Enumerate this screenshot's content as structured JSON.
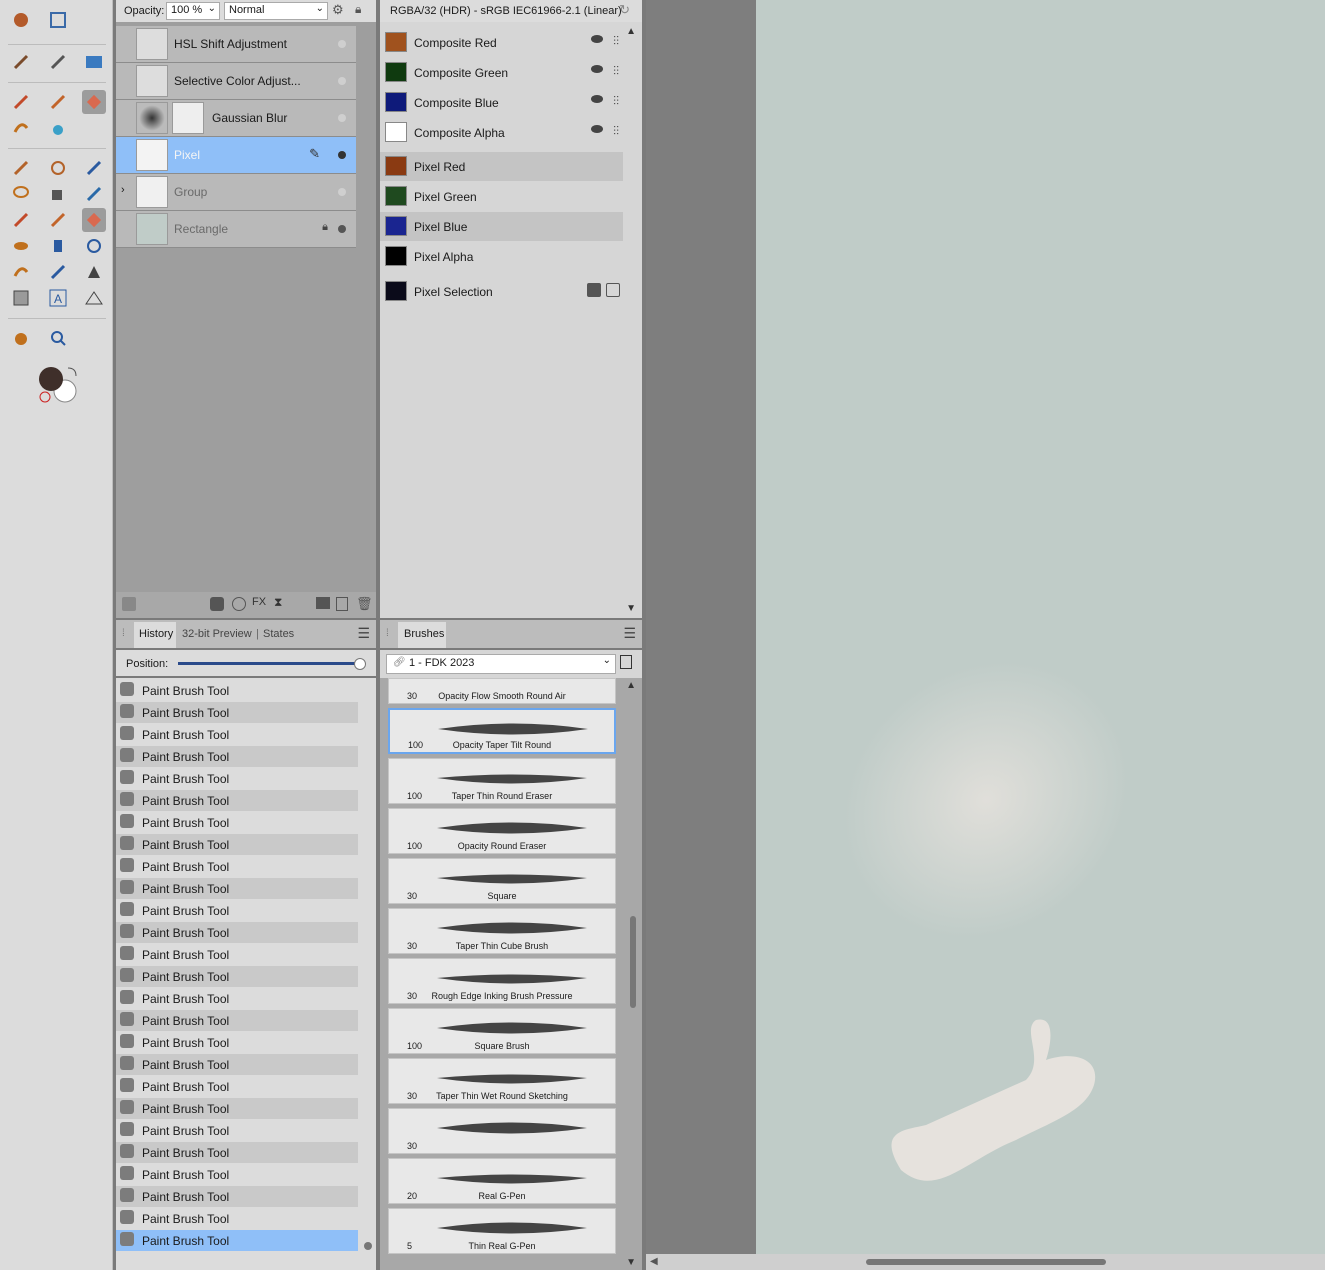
{
  "toolbar": {
    "tools": [
      "brush-adjust",
      "warp",
      "color-picker",
      "eyedropper",
      "image",
      "paint-brush",
      "pixel-brush",
      "erase-brush",
      "smudge",
      "blur-drop",
      "selection-brush",
      "color-replace",
      "magic-wand",
      "lasso",
      "flood-fill",
      "clone",
      "paint-brush-2",
      "mixer-brush",
      "erase-brush-2",
      "dodge",
      "burn",
      "sponge",
      "smudge-2",
      "pixel-picker",
      "pen",
      "rectangle",
      "text",
      "mesh",
      "hand",
      "zoom"
    ]
  },
  "layers_panel": {
    "opacity_label": "Opacity:",
    "opacity_value": "100 %",
    "blend_mode": "Normal",
    "layers": [
      {
        "name": "HSL Shift Adjustment"
      },
      {
        "name": "Selective Color Adjust..."
      },
      {
        "name": "Gaussian Blur"
      },
      {
        "name": "Pixel"
      },
      {
        "name": "Group"
      },
      {
        "name": "Rectangle"
      }
    ]
  },
  "channels_panel": {
    "title": "RGBA/32 (HDR) - sRGB IEC61966-2.1 (Linear)",
    "composite": [
      {
        "name": "Composite Red",
        "color": "#a0521e"
      },
      {
        "name": "Composite Green",
        "color": "#0f3a0f"
      },
      {
        "name": "Composite Blue",
        "color": "#0e1a7a"
      },
      {
        "name": "Composite Alpha",
        "color": "#ffffff"
      }
    ],
    "pixel": [
      {
        "name": "Pixel Red",
        "color": "#8a3a12"
      },
      {
        "name": "Pixel Green",
        "color": "#1f4a1f"
      },
      {
        "name": "Pixel Blue",
        "color": "#1a2590"
      },
      {
        "name": "Pixel Alpha",
        "color": "#000000"
      }
    ],
    "selection": {
      "name": "Pixel Selection",
      "color": "#0b0b1a"
    }
  },
  "history_panel": {
    "tabs": [
      "History",
      "32-bit Preview",
      "States"
    ],
    "position_label": "Position:",
    "position_fraction": 1.0,
    "items": [
      "Paint Brush Tool",
      "Paint Brush Tool",
      "Paint Brush Tool",
      "Paint Brush Tool",
      "Paint Brush Tool",
      "Paint Brush Tool",
      "Paint Brush Tool",
      "Paint Brush Tool",
      "Paint Brush Tool",
      "Paint Brush Tool",
      "Paint Brush Tool",
      "Paint Brush Tool",
      "Paint Brush Tool",
      "Paint Brush Tool",
      "Paint Brush Tool",
      "Paint Brush Tool",
      "Paint Brush Tool",
      "Paint Brush Tool",
      "Paint Brush Tool",
      "Paint Brush Tool",
      "Paint Brush Tool",
      "Paint Brush Tool",
      "Paint Brush Tool",
      "Paint Brush Tool",
      "Paint Brush Tool",
      "Paint Brush Tool"
    ]
  },
  "brushes_panel": {
    "tab": "Brushes",
    "category": "1 - FDK 2023",
    "brushes": [
      {
        "size": "30",
        "name": "Opacity Flow Smooth Round Air"
      },
      {
        "size": "100",
        "name": "Opacity Taper Tilt Round"
      },
      {
        "size": "100",
        "name": "Taper Thin Round Eraser"
      },
      {
        "size": "100",
        "name": "Opacity Round Eraser"
      },
      {
        "size": "30",
        "name": "Square"
      },
      {
        "size": "30",
        "name": "Taper Thin Cube Brush"
      },
      {
        "size": "30",
        "name": "Rough Edge Inking Brush Pressure"
      },
      {
        "size": "100",
        "name": "Square Brush"
      },
      {
        "size": "30",
        "name": "Taper Thin Wet Round Sketching"
      },
      {
        "size": "30",
        "name": ""
      },
      {
        "size": "20",
        "name": "Real G-Pen"
      },
      {
        "size": "5",
        "name": "Thin Real G-Pen"
      }
    ]
  },
  "colors": {
    "primary": "#3f2f2a",
    "secondary": "#ffffff",
    "canvas": "#c0ccc8",
    "paint": "#e6e2dd",
    "selection": "#8fbff8"
  }
}
